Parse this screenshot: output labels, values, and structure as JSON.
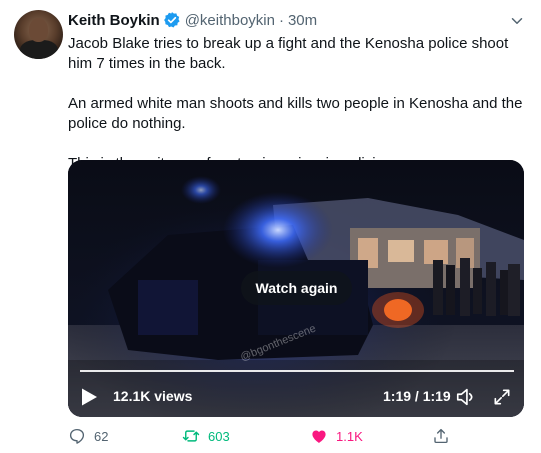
{
  "author": {
    "display_name": "Keith Boykin",
    "handle": "@keithboykin",
    "separator": "·",
    "time": "30m",
    "verified": true
  },
  "tweet_text": {
    "paragraph_1": "Jacob Blake tries to break up a fight and the Kenosha police shoot him 7 times in the back.",
    "paragraph_2": "An armed white man shoots and kills two people in Kenosha and the police do nothing.",
    "paragraph_3": "This is the epitome of systemic racism in policing."
  },
  "video": {
    "overlay_button": "Watch again",
    "views": "12.1K views",
    "timecode": "1:19 / 1:19",
    "watermark": "@bgonthescene",
    "progress": 1.0
  },
  "actions": {
    "replies": "62",
    "retweets": "603",
    "likes": "1.1K"
  },
  "colors": {
    "verified": "#1d9bf0",
    "retweet_active": "#00ba7c",
    "like_active": "#f91880",
    "muted_text": "#536471"
  },
  "icons": {
    "caret": "chevron-down-icon",
    "verified": "verified-badge-icon",
    "play": "play-icon",
    "volume": "volume-icon",
    "fullscreen": "fullscreen-icon",
    "reply": "reply-icon",
    "retweet": "retweet-icon",
    "like": "heart-icon",
    "share": "share-icon"
  }
}
